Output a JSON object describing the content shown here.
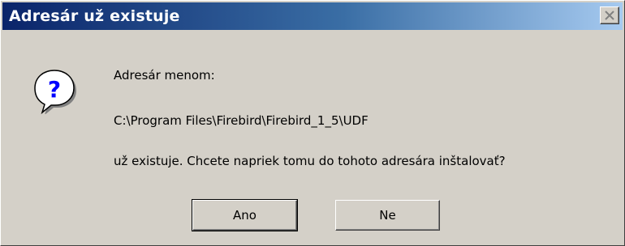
{
  "dialog": {
    "title": "Adresár už existuje",
    "icon": "question-icon",
    "close_icon": "close-icon",
    "message": {
      "line1": "Adresár menom:",
      "path": "C:\\Program Files\\Firebird\\Firebird_1_5\\UDF",
      "line3": "už existuje. Chcete napriek tomu do tohoto adresára inštalovať?"
    },
    "buttons": {
      "yes_label": "Ano",
      "no_label": "Ne"
    }
  },
  "colors": {
    "titlebar_start": "#0a246a",
    "titlebar_end": "#a6caf0",
    "face": "#d4d0c8"
  }
}
